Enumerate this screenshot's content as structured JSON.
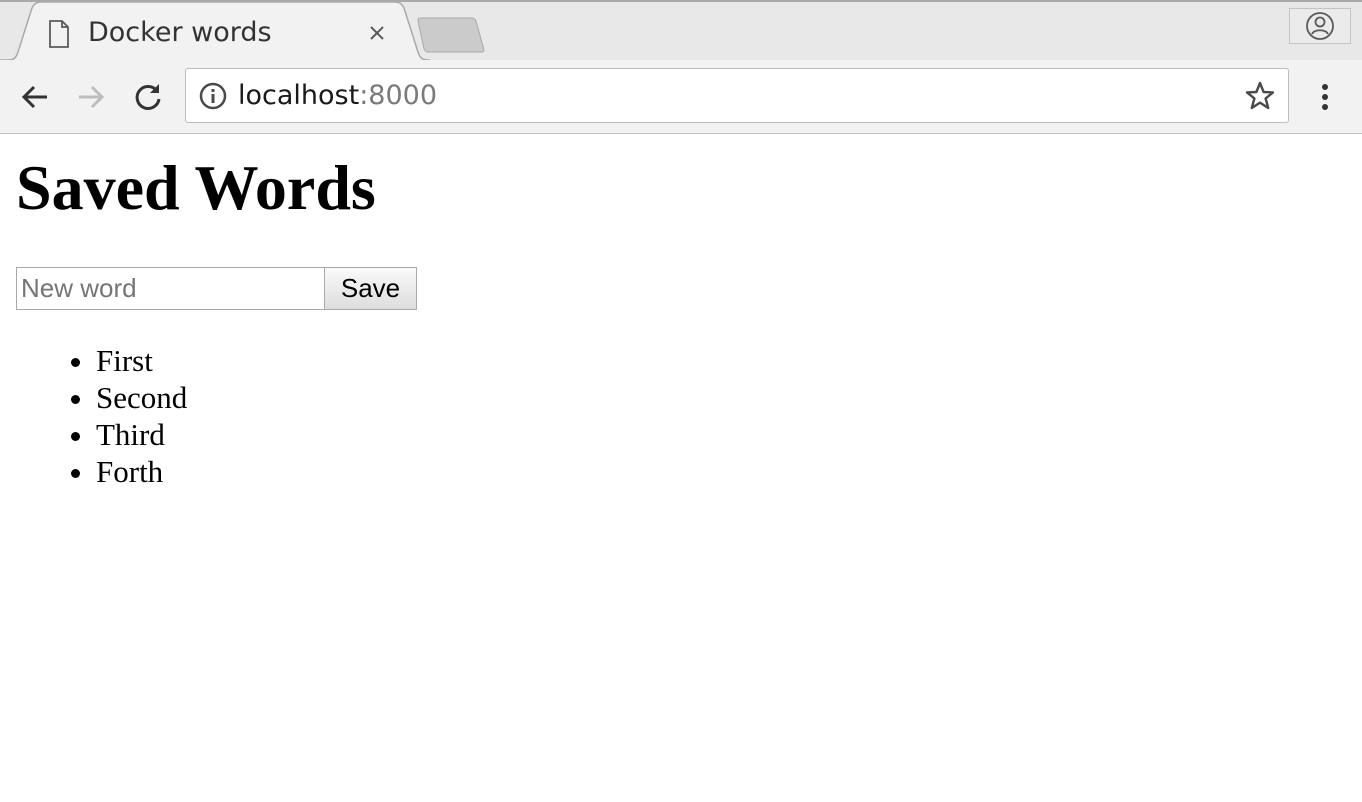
{
  "browser": {
    "tab": {
      "title": "Docker words",
      "favicon": "page-icon",
      "close": "close-icon"
    },
    "new_tab": "new-tab-icon",
    "profile": "profile-icon",
    "toolbar": {
      "back": "back-arrow-icon",
      "forward": "forward-arrow-icon",
      "reload": "reload-icon",
      "menu": "kebab-menu-icon",
      "bookmark": "star-icon",
      "site_info": "info-icon"
    },
    "address": {
      "host": "localhost",
      "port": ":8000"
    }
  },
  "page": {
    "title": "Saved Words",
    "form": {
      "placeholder": "New word",
      "value": "",
      "save_label": "Save"
    },
    "words": [
      "First",
      "Second",
      "Third",
      "Forth"
    ]
  },
  "colors": {
    "chrome_bg": "#ececec",
    "text": "#000000",
    "placeholder": "#757575",
    "url_port": "#7a7a7a"
  }
}
